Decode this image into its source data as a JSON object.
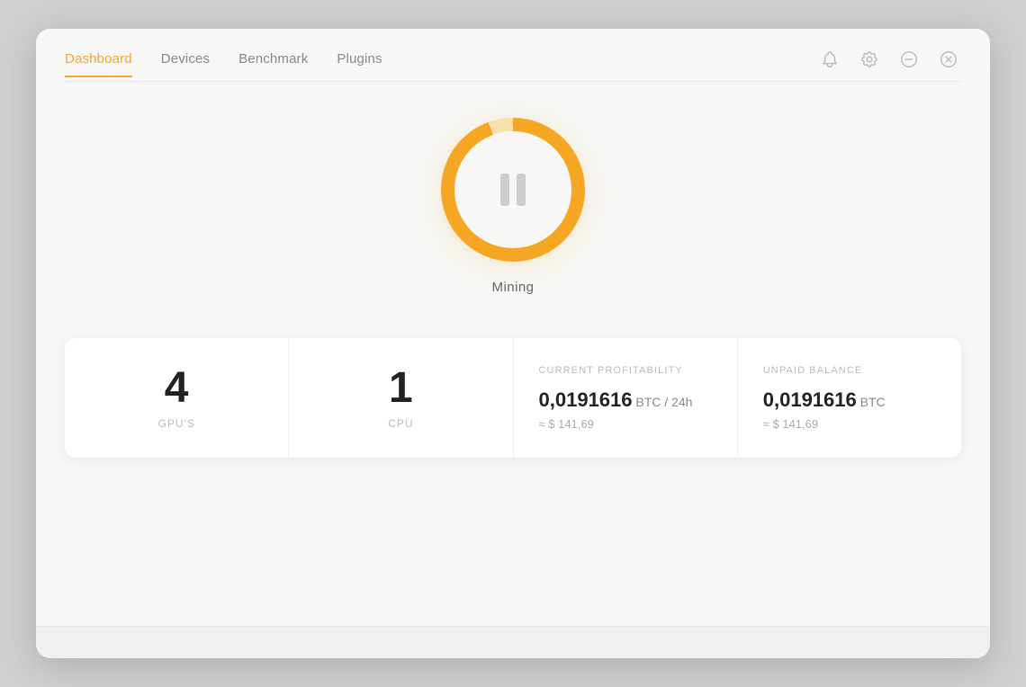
{
  "nav": {
    "items": [
      {
        "label": "Dashboard",
        "active": true
      },
      {
        "label": "Devices",
        "active": false
      },
      {
        "label": "Benchmark",
        "active": false
      },
      {
        "label": "Plugins",
        "active": false
      }
    ],
    "icons": [
      {
        "name": "bell-icon",
        "symbol": "bell"
      },
      {
        "name": "settings-icon",
        "symbol": "gear"
      },
      {
        "name": "minimize-icon",
        "symbol": "minus"
      },
      {
        "name": "close-icon",
        "symbol": "x-circle"
      }
    ]
  },
  "mining": {
    "status_label": "Mining",
    "button_state": "paused"
  },
  "stats": [
    {
      "id": "gpus",
      "value": "4",
      "label": "GPU'S"
    },
    {
      "id": "cpu",
      "value": "1",
      "label": "CPU"
    },
    {
      "id": "profitability",
      "card_label": "CURRENT PROFITABILITY",
      "main_value": "0,0191616",
      "unit": " BTC / 24h",
      "approx": "≈ $ 141,69"
    },
    {
      "id": "balance",
      "card_label": "UNPAID BALANCE",
      "main_value": "0,0191616",
      "unit": " BTC",
      "approx": "≈ $ 141,69"
    }
  ],
  "colors": {
    "accent": "#f5a623",
    "nav_active": "#f5a623",
    "text_primary": "#222",
    "text_muted": "#888",
    "text_light": "#bbb"
  }
}
